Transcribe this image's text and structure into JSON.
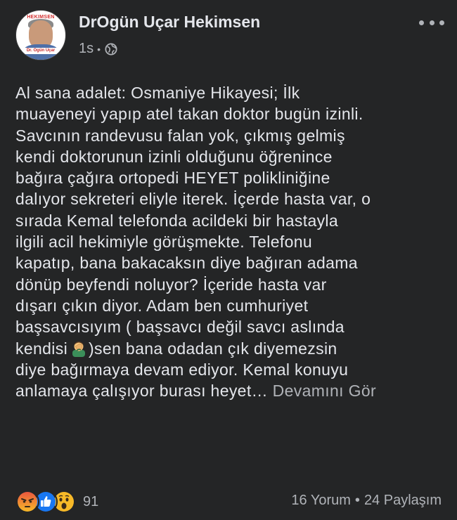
{
  "post": {
    "author": "DrOgün Uçar Hekimsen",
    "time": "1s",
    "meta_separator": "•",
    "privacy_icon": "globe-icon",
    "avatar_badge": "HEKIMSEN",
    "avatar_caption": "Dr. Ogün Uçar",
    "text_lines": [
      "Al sana adalet: Osmaniye Hikayesi; İlk",
      "muayeneyi yapıp atel takan doktor bugün izinli.",
      "Savcının randevusu falan yok, çıkmış gelmiş",
      "kendi doktorunun izinli olduğunu öğrenince",
      "bağıra çağıra ortopedi HEYET polikliniğine",
      "dalıyor sekreteri eliyle iterek. İçerde hasta var, o",
      "sırada Kemal telefonda acildeki bir hastayla",
      "ilgili acil hekimiyle görüşmekte. Telefonu",
      "kapatıp, bana bakacaksın diye bağıran adama",
      "dönüp beyfendi noluyor? İçeride hasta var",
      "dışarı çıkın diyor. Adam ben cumhuriyet",
      "başsavcısıyım ( başsavcı değil savcı aslında"
    ],
    "line_emoji_before": "kendisi",
    "line_emoji_after": ")sen bana odadan çık diyemezsin",
    "inline_emoji": "man-facepalming-emoji",
    "text_lines_after": [
      "diye bağırmaya devam ediyor. Kemal konuyu"
    ],
    "last_line": "anlamaya çalışıyor burası heyet…",
    "see_more": "Devamını Gör"
  },
  "reactions": {
    "icons": [
      "angry-reaction-icon",
      "like-reaction-icon",
      "wow-reaction-icon"
    ],
    "count": "91"
  },
  "stats": {
    "comments": "16 Yorum",
    "separator": "•",
    "shares": "24 Paylaşım"
  },
  "colors": {
    "background": "#242526",
    "primary_text": "#e4e6eb",
    "secondary_text": "#b0b3b8",
    "like_blue": "#1877f2",
    "reaction_yellow": "#f7b928"
  }
}
